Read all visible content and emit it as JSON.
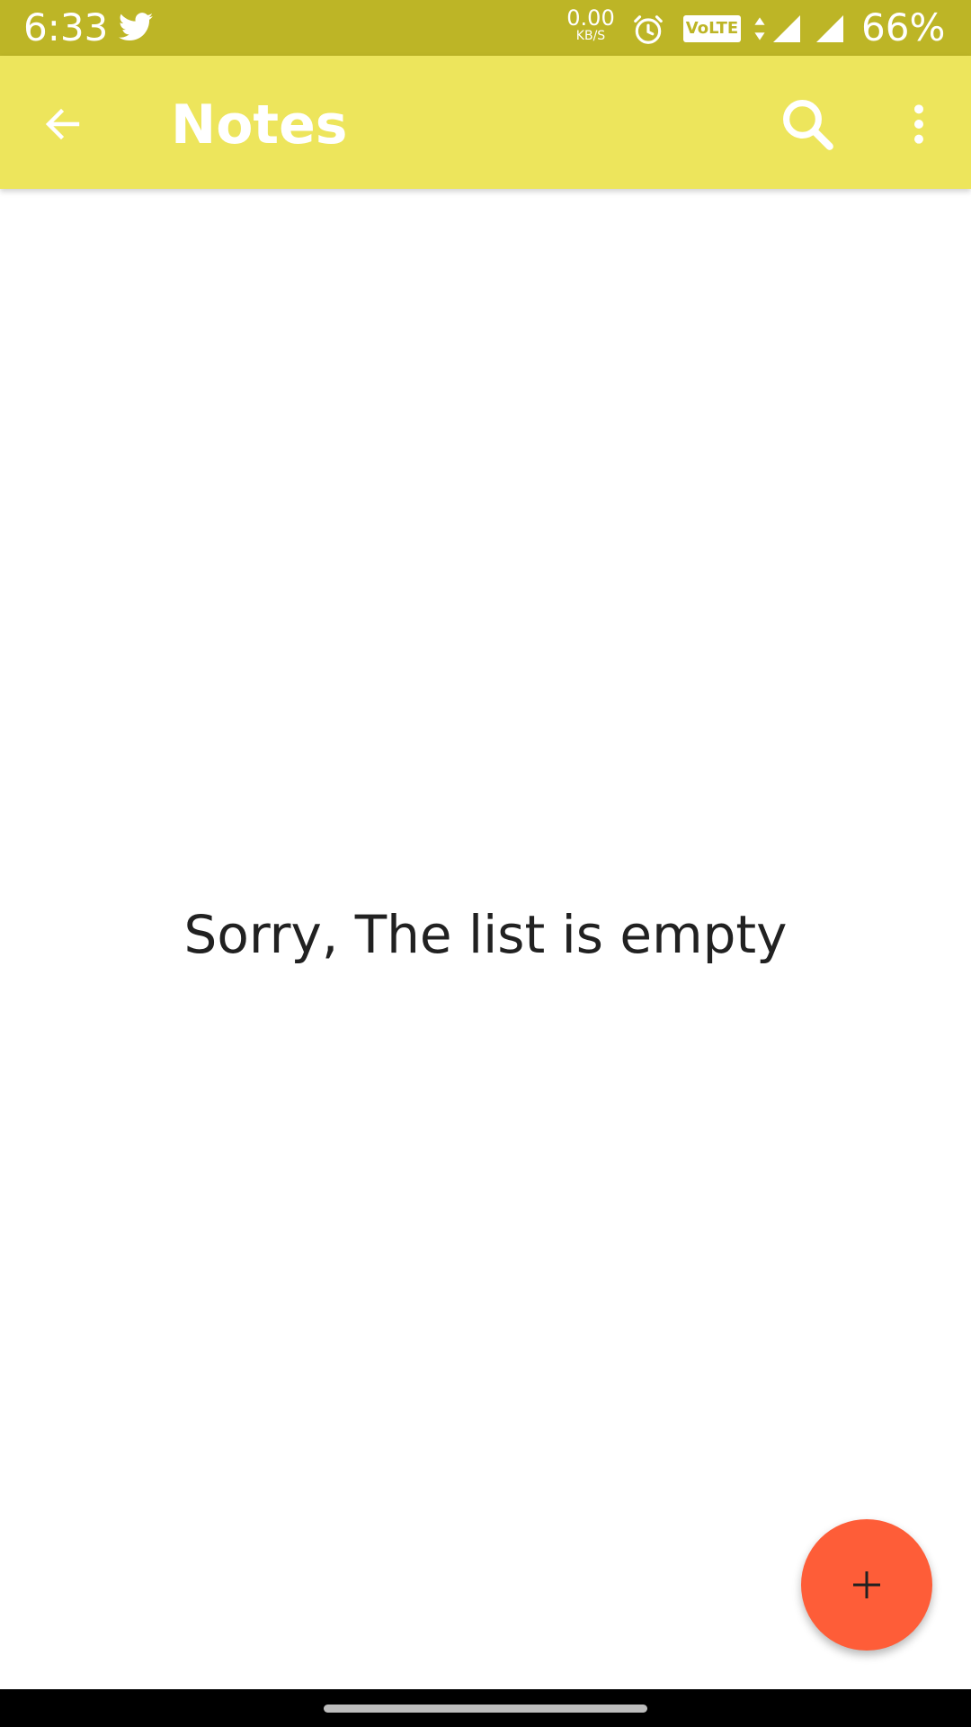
{
  "status_bar": {
    "time": "6:33",
    "net_speed_value": "0.00",
    "net_speed_unit": "KB/S",
    "volte": "VoLTE",
    "battery": "66%",
    "icons": [
      "twitter-icon",
      "alarm-icon",
      "data-arrows-icon",
      "signal-icon",
      "signal-icon",
      "battery-text"
    ]
  },
  "app_bar": {
    "title": "Notes",
    "back_icon": "arrow-left-icon",
    "search_icon": "search-icon",
    "more_icon": "more-vertical-icon"
  },
  "content": {
    "empty_message": "Sorry, The list is empty"
  },
  "fab": {
    "icon": "plus-icon"
  },
  "colors": {
    "status_bar": "#bdb526",
    "app_bar": "#ede55c",
    "fab": "#fe5d38",
    "text": "#212121",
    "nav_bar": "#000000"
  }
}
